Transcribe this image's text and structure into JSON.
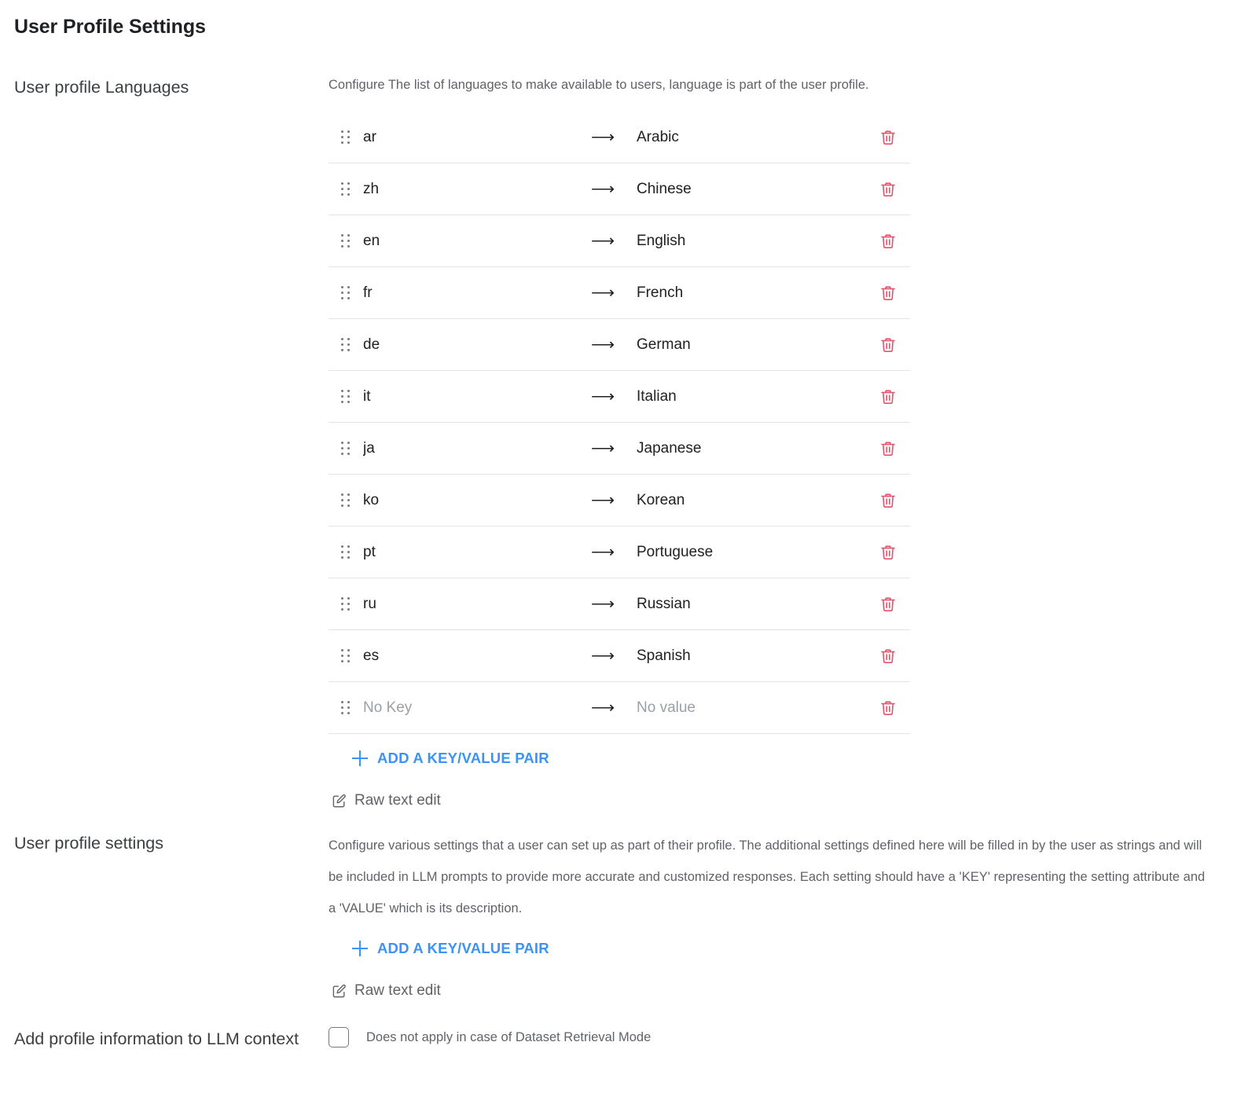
{
  "page": {
    "title": "User Profile Settings"
  },
  "sections": {
    "languages": {
      "label": "User profile Languages",
      "description": "Configure The list of languages to make available to users, language is part of the user profile.",
      "add_button_label": "ADD A KEY/VALUE PAIR",
      "raw_edit_label": "Raw text edit",
      "arrow_glyph": "⟶",
      "rows": [
        {
          "key": "ar",
          "value": "Arabic"
        },
        {
          "key": "zh",
          "value": "Chinese"
        },
        {
          "key": "en",
          "value": "English"
        },
        {
          "key": "fr",
          "value": "French"
        },
        {
          "key": "de",
          "value": "German"
        },
        {
          "key": "it",
          "value": "Italian"
        },
        {
          "key": "ja",
          "value": "Japanese"
        },
        {
          "key": "ko",
          "value": "Korean"
        },
        {
          "key": "pt",
          "value": "Portuguese"
        },
        {
          "key": "ru",
          "value": "Russian"
        },
        {
          "key": "es",
          "value": "Spanish"
        },
        {
          "key": "No Key",
          "value": "No value",
          "placeholder": true
        }
      ]
    },
    "settings": {
      "label": "User profile settings",
      "description": "Configure various settings that a user can set up as part of their profile. The additional settings defined here will be filled in by the user as strings and will be included in LLM prompts to provide more accurate and customized responses. Each setting should have a 'KEY' representing the setting attribute and a 'VALUE' which is its description.",
      "add_button_label": "ADD A KEY/VALUE PAIR",
      "raw_edit_label": "Raw text edit"
    },
    "profile_context": {
      "label": "Add profile information to LLM context",
      "checkbox_checked": false,
      "checkbox_label": "Does not apply in case of Dataset Retrieval Mode"
    }
  },
  "colors": {
    "accent_blue": "#3b93f7",
    "delete_red": "#e5536b",
    "text_primary": "#202124",
    "text_secondary": "#5f6368",
    "text_placeholder": "#9aa0a6",
    "divider": "#e4e4e4"
  },
  "icons": {
    "drag_handle": "drag-handle-icon",
    "delete": "trash-icon",
    "add": "plus-icon",
    "raw_edit": "edit-square-icon"
  }
}
